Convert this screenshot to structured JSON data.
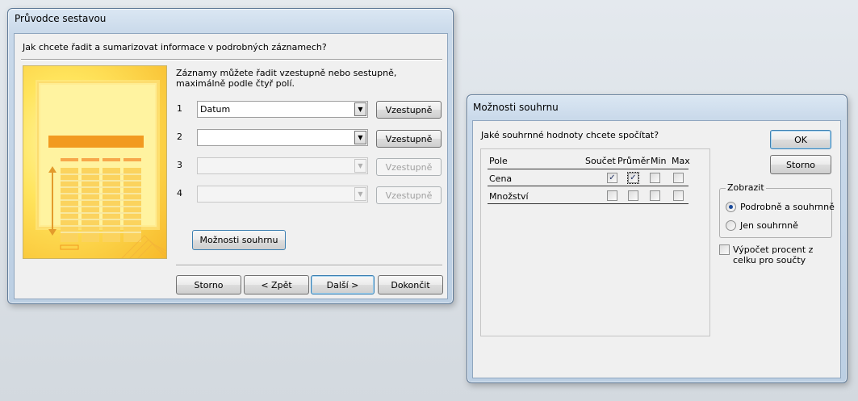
{
  "wizard": {
    "title": "Průvodce sestavou",
    "question": "Jak chcete řadit a sumarizovat informace v podrobných záznamech?",
    "instruction": "Záznamy můžete řadit vzestupně nebo sestupně, maximálně podle čtyř polí.",
    "sort_rows": [
      {
        "num": "1",
        "value": "Datum",
        "button": "Vzestupně",
        "enabled": true
      },
      {
        "num": "2",
        "value": "",
        "button": "Vzestupně",
        "enabled": true
      },
      {
        "num": "3",
        "value": "",
        "button": "Vzestupně",
        "enabled": false
      },
      {
        "num": "4",
        "value": "",
        "button": "Vzestupně",
        "enabled": false
      }
    ],
    "summary_button": "Možnosti souhrnu",
    "buttons": {
      "cancel": "Storno",
      "back": "< Zpět",
      "next": "Další >",
      "finish": "Dokončit"
    }
  },
  "summary": {
    "title": "Možnosti souhrnu",
    "question": "Jaké souhrnné hodnoty chcete spočítat?",
    "columns": {
      "field": "Pole",
      "sum": "Součet",
      "avg": "Průměr",
      "min": "Min",
      "max": "Max"
    },
    "rows": [
      {
        "field": "Cena",
        "sum": true,
        "avg": false,
        "min": false,
        "max": false
      },
      {
        "field": "Množství",
        "sum": false,
        "avg": false,
        "min": false,
        "max": false
      }
    ],
    "ok": "OK",
    "cancel": "Storno",
    "show_group": "Zobrazit",
    "show_options": [
      {
        "label": "Podrobně a souhrnně",
        "selected": true
      },
      {
        "label": "Jen souhrnně",
        "selected": false
      }
    ],
    "percent_label": "Výpočet procent z celku pro součty",
    "percent_checked": false
  }
}
